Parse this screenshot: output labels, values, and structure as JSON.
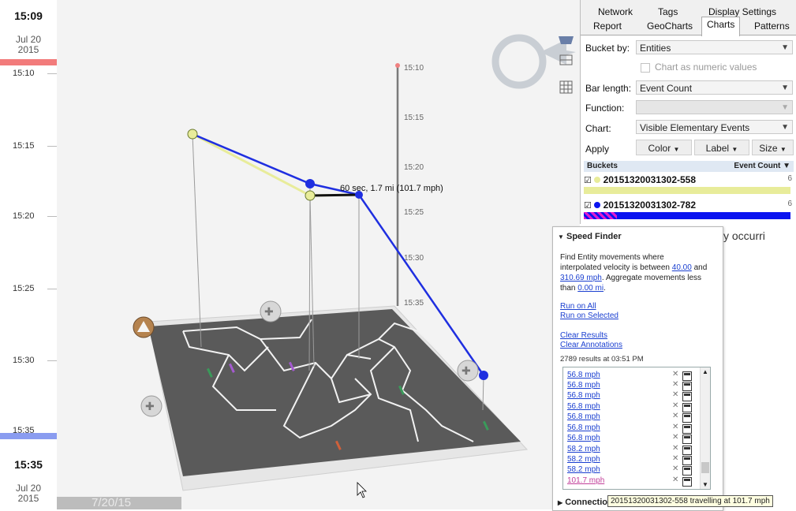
{
  "timeline": {
    "top_time": "15:09",
    "top_date_day": "Jul 20",
    "top_date_year": "2015",
    "bottom_time": "15:35",
    "bottom_date_day": "Jul 20",
    "bottom_date_year": "2015",
    "ticks": [
      "15:10",
      "15:15",
      "15:20",
      "15:25",
      "15:30",
      "15:35"
    ],
    "top_band_color": "#f27b7b",
    "bottom_band_color": "#8a9cf0"
  },
  "viewer": {
    "axis_ticks": [
      "15:10",
      "15:15",
      "15:20",
      "15:25",
      "15:30",
      "15:35"
    ],
    "segment_label": "60 sec, 1.7 mi (101.7 mph)",
    "date_tab": "7/20/15",
    "track_color_1": "#1f2fe0",
    "track_color_2": "#e8ec9a"
  },
  "tabs": {
    "row1": [
      "Network",
      "Tags",
      "Display Settings"
    ],
    "row2": [
      "Report",
      "GeoCharts",
      "Charts",
      "Patterns"
    ],
    "active": "Charts"
  },
  "charts": {
    "bucket_by_label": "Bucket by:",
    "bucket_by_value": "Entities",
    "numeric_checkbox_label": "Chart as numeric values",
    "bar_length_label": "Bar length:",
    "bar_length_value": "Event Count",
    "function_label": "Function:",
    "function_value": "",
    "chart_label": "Chart:",
    "chart_value": "Visible Elementary Events",
    "apply_label": "Apply",
    "apply_buttons": [
      "Color",
      "Label",
      "Size"
    ],
    "buckets_header": "Buckets",
    "count_header": "Event Count",
    "buckets": [
      {
        "label": "20151320031302-558",
        "count": "6",
        "color": "#e8ec9a"
      },
      {
        "label": "20151320031302-782",
        "count": "6",
        "color": "#0a14f0"
      }
    ]
  },
  "speed_finder": {
    "title": "Speed Finder",
    "desc_1": "Find Entity movements where",
    "desc_2": "interpolated velocity is between",
    "min_speed": "40.00",
    "desc_and": "and",
    "max_speed": "310.69 mph",
    "desc_3": ". Aggregate movements less",
    "desc_4": "than",
    "min_dist": "0.00 mi",
    "desc_period": ".",
    "run_all": "Run on All",
    "run_selected": "Run on Selected",
    "clear_results": "Clear Results",
    "clear_annotations": "Clear Annotations",
    "results_text": "2789 results at 03:51 PM",
    "results": [
      "56.8 mph",
      "56.8 mph",
      "56.8 mph",
      "56.8 mph",
      "56.8 mph",
      "56.8 mph",
      "56.8 mph",
      "58.2 mph",
      "58.2 mph",
      "58.2 mph",
      "101.7 mph"
    ],
    "next_section": "Connectio",
    "tooltip": "20151320031302-558 travelling at 101.7 mph"
  },
  "background_text": "y occurri"
}
